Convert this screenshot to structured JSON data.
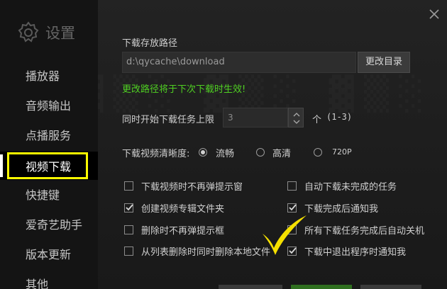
{
  "sidebar": {
    "title": "设置",
    "items": [
      {
        "label": "播放器"
      },
      {
        "label": "音频输出"
      },
      {
        "label": "点播服务"
      },
      {
        "label": "视频下载"
      },
      {
        "label": "快捷键"
      },
      {
        "label": "爱奇艺助手"
      },
      {
        "label": "版本更新"
      },
      {
        "label": "其他"
      }
    ],
    "active_item": "视频下载"
  },
  "download": {
    "path_label": "下载存放路径",
    "path_value": "d:\\qycache\\download",
    "change_dir_button": "更改目录",
    "path_note": "更改路径将于下次下载时生效!",
    "max_tasks_label": "同时开始下载任务上限",
    "max_tasks_value": "3",
    "max_tasks_unit": "个",
    "max_tasks_range": "(1-3)",
    "quality_label": "下载视频清晰度:",
    "quality_options": [
      "流畅",
      "高清",
      "720P"
    ],
    "quality_selected": "流畅"
  },
  "options": [
    {
      "label": "下载视频时不再弹提示窗",
      "checked": false
    },
    {
      "label": "自动下载未完成的任务",
      "checked": false
    },
    {
      "label": "创建视频专辑文件夹",
      "checked": true
    },
    {
      "label": "下载完成后通知我",
      "checked": true
    },
    {
      "label": "删除时不再弹提示框",
      "checked": false
    },
    {
      "label": "所有下载任务完成后自动关机",
      "checked": false
    },
    {
      "label": "从列表删除时同时删除本地文件",
      "checked": false
    },
    {
      "label": "下载中退出程序时通知我",
      "checked": true
    }
  ],
  "annotation": {
    "highlight_color": "#ffff00",
    "checkmark_color": "#f5e000"
  },
  "colors": {
    "note_green": "#4fcf22",
    "sidebar_bg": "#141414"
  }
}
